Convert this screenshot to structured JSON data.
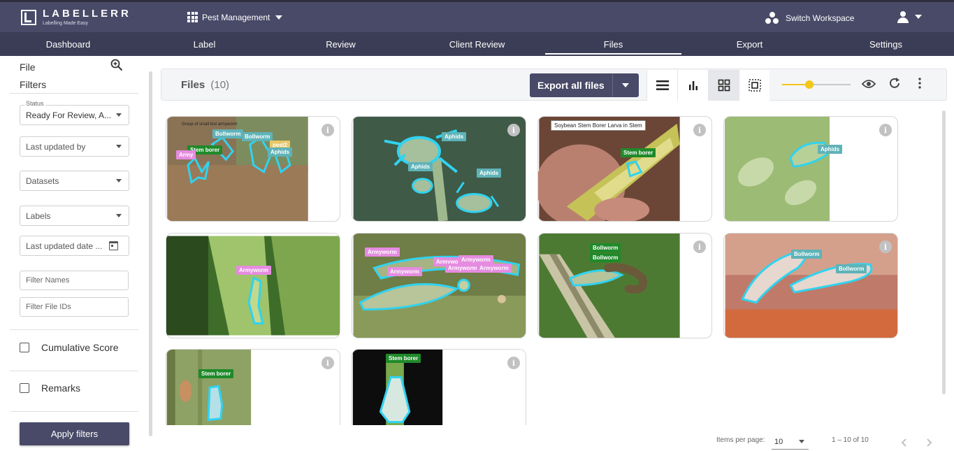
{
  "app": {
    "logo_title": "LABELLERR",
    "logo_tagline": "Labelling Made Easy",
    "project_name": "Pest Management",
    "switch_workspace_label": "Switch Workspace"
  },
  "nav": {
    "items": [
      {
        "label": "Dashboard"
      },
      {
        "label": "Label"
      },
      {
        "label": "Review"
      },
      {
        "label": "Client Review"
      },
      {
        "label": "Files"
      },
      {
        "label": "Export"
      },
      {
        "label": "Settings"
      }
    ],
    "active": "Files"
  },
  "sidebar": {
    "title": "File\nFilters",
    "status_label": "Status",
    "status_value": "Ready For Review, A...",
    "last_updated_by": "Last updated by",
    "datasets": "Datasets",
    "labels": "Labels",
    "last_updated_date": "Last updated date ...",
    "filter_names_placeholder": "Filter Names",
    "filter_file_ids_placeholder": "Filter File IDs",
    "cumulative_score_label": "Cumulative Score",
    "remarks_label": "Remarks",
    "apply_filters_label": "Apply filters"
  },
  "toolbar": {
    "files_label": "Files",
    "files_count": "(10)",
    "export_label": "Export all files",
    "thumbnail_size_fraction": 0.4
  },
  "cards": [
    {
      "tags": [
        "Bollworm",
        "Bollworm",
        "Stem borer",
        "Army",
        "pest2",
        "Aphids"
      ],
      "caption": "Group of small lost armyworm"
    },
    {
      "tags": [
        "Aphids",
        "Aphids",
        "Aphids"
      ]
    },
    {
      "tags": [
        "Stem borer"
      ],
      "caption": "Soybean Stem Borer Larva in Stem"
    },
    {
      "tags": [
        "Aphids"
      ]
    },
    {
      "tags": [
        "Armyworm"
      ]
    },
    {
      "tags": [
        "Armyworm",
        "Armyworm",
        "Armywor",
        "Armyworm",
        "Armyworm",
        "Armyworm"
      ]
    },
    {
      "tags": [
        "Bollworm",
        "Bollworm"
      ]
    },
    {
      "tags": [
        "Bollworm",
        "Bollworm"
      ]
    },
    {
      "tags": [
        "Stem borer"
      ]
    },
    {
      "tags": [
        "Stem borer"
      ]
    }
  ],
  "pager": {
    "items_per_page_label": "Items per page:",
    "items_per_page_value": "10",
    "range_label": "1 – 10 of 10"
  },
  "colors": {
    "topbar": "#494a68",
    "navbar": "#3b3c55",
    "accent_yellow": "#f5c518",
    "annotation_outline": "#2fd3f0",
    "tag_green": "#1f8a2a",
    "tag_teal": "#5fb3b8",
    "tag_pink": "#e58ce0"
  }
}
